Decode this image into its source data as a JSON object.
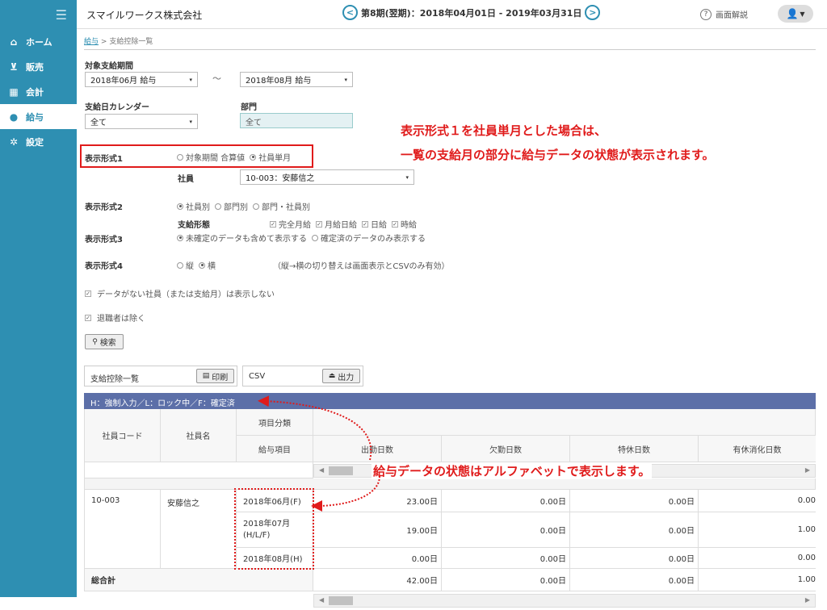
{
  "sidebar": {
    "items": [
      {
        "label": "ホーム",
        "icon": "home-icon"
      },
      {
        "label": "販売",
        "icon": "cart-icon"
      },
      {
        "label": "会計",
        "icon": "calculator-icon"
      },
      {
        "label": "給与",
        "icon": "money-bag-icon"
      },
      {
        "label": "設定",
        "icon": "gear-icon"
      }
    ],
    "active_index": 3
  },
  "header": {
    "company": "スマイルワークス株式会社",
    "period": "第8期(翌期)：2018年04月01日 - 2019年03月31日",
    "prev": "<",
    "next": ">",
    "help_label": "画面解説",
    "help_q": "?"
  },
  "breadcrumb": {
    "link": "給与",
    "sep": ">",
    "current": "支給控除一覧"
  },
  "form": {
    "period_label": "対象支給期間",
    "period_from": "2018年06月 給与",
    "period_tilde": "～",
    "period_to": "2018年08月 給与",
    "calendar_label": "支給日カレンダー",
    "calendar_value": "全て",
    "dept_label": "部門",
    "dept_value": "全て",
    "format1_label": "表示形式1",
    "format1_opt1": "対象期間 合算値",
    "format1_opt2": "社員単月",
    "employee_label": "社員",
    "employee_value": "10-003：安藤信之",
    "format2_label": "表示形式2",
    "format2_opt1": "社員別",
    "format2_opt2": "部門別",
    "format2_opt3": "部門・社員別",
    "pay_type_label": "支給形態",
    "pay_types": [
      "完全月給",
      "月給日給",
      "日給",
      "時給"
    ],
    "format3_label": "表示形式3",
    "format3_opt1": "未確定のデータも含めて表示する",
    "format3_opt2": "確定済のデータのみ表示する",
    "format4_label": "表示形式4",
    "format4_opt1": "縦",
    "format4_opt2": "横",
    "format4_note": "（縦→横の切り替えは画面表示とCSVのみ有効）",
    "check1": "データがない社員（または支給月）は表示しない",
    "check2": "退職者は除く",
    "search_btn": "検索",
    "search_icon": "search-icon"
  },
  "output": {
    "list_label": "支給控除一覧",
    "print_btn": "印刷",
    "csv_label": "CSV",
    "export_btn": "出力"
  },
  "annotations": {
    "line1": "表示形式１を社員単月とした場合は、",
    "line2": "一覧の支給月の部分に給与データの状態が表示されます。",
    "line3": "給与データの状態はアルファベットで表示します。"
  },
  "table": {
    "legend": "H：強制入力／L：ロック中／F：確定済",
    "h_code": "社員コード",
    "h_name": "社員名",
    "h_category": "項目分類",
    "h_item": "給与項目",
    "columns": [
      "出勤日数",
      "欠勤日数",
      "特休日数",
      "有休消化日数"
    ],
    "employee_code": "10-003",
    "employee_name": "安藤信之",
    "rows": [
      {
        "month": "2018年06月(F)",
        "values": [
          "23.00日",
          "0.00日",
          "0.00日",
          "0.00"
        ]
      },
      {
        "month": "2018年07月\n(H/L/F)",
        "values": [
          "19.00日",
          "0.00日",
          "0.00日",
          "1.00"
        ]
      },
      {
        "month": "2018年08月(H)",
        "values": [
          "0.00日",
          "0.00日",
          "0.00日",
          "0.00"
        ]
      }
    ],
    "total_label": "総合計",
    "total_values": [
      "42.00日",
      "0.00日",
      "0.00日",
      "1.00"
    ]
  },
  "colors": {
    "sidebar": "#2e8fb2",
    "band": "#5c6fa8",
    "annotation": "#e01b1b"
  }
}
